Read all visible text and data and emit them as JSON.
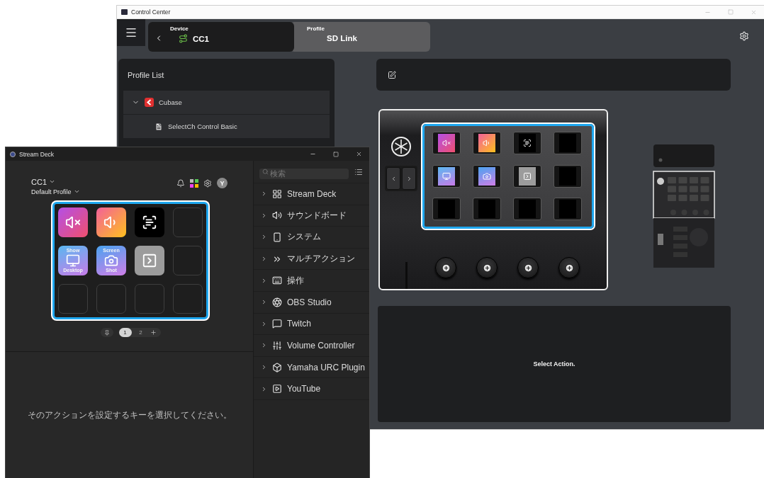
{
  "control_center": {
    "title": "Control Center",
    "tabs": [
      {
        "kind": "device",
        "label": "Device",
        "value": "CC1",
        "selected": true
      },
      {
        "kind": "profile",
        "label": "Profile",
        "value": "SD Link",
        "selected": false
      }
    ],
    "profile_list": {
      "title": "Profile List",
      "items": [
        {
          "kind": "app",
          "name": "Cubase",
          "expanded": true,
          "children": [
            {
              "kind": "file",
              "name": "SelectCh Control Basic"
            }
          ]
        }
      ]
    },
    "controller_keys": [
      {
        "kind": "mute"
      },
      {
        "kind": "volume"
      },
      {
        "kind": "text"
      },
      {
        "kind": "empty"
      },
      {
        "kind": "desktop"
      },
      {
        "kind": "screenshot"
      },
      {
        "kind": "switch"
      },
      {
        "kind": "empty"
      },
      {
        "kind": "empty"
      },
      {
        "kind": "empty"
      },
      {
        "kind": "empty"
      },
      {
        "kind": "empty"
      }
    ],
    "message": "Select Action."
  },
  "stream_deck": {
    "title": "Stream Deck",
    "device": "CC1",
    "profile": "Default Profile",
    "avatar": "Y",
    "keys": [
      {
        "kind": "mute"
      },
      {
        "kind": "volume"
      },
      {
        "kind": "text"
      },
      {
        "kind": "empty"
      },
      {
        "kind": "desktop",
        "top": "Show",
        "bottom": "Desktop"
      },
      {
        "kind": "screenshot",
        "top": "Screen",
        "bottom": "Shot"
      },
      {
        "kind": "switch"
      },
      {
        "kind": "empty"
      },
      {
        "kind": "empty"
      },
      {
        "kind": "empty"
      },
      {
        "kind": "empty"
      },
      {
        "kind": "empty"
      }
    ],
    "pages": [
      {
        "label": "1",
        "selected": true
      },
      {
        "label": "2",
        "selected": false
      }
    ],
    "message": "そのアクションを設定するキーを選択してください。",
    "search": {
      "placeholder": "検索"
    },
    "categories": [
      {
        "kind": "streamdeck",
        "name": "Stream Deck",
        "expanded": false
      },
      {
        "kind": "soundboard",
        "name": "サウンドボード",
        "expanded": false
      },
      {
        "kind": "system",
        "name": "システム",
        "expanded": false
      },
      {
        "kind": "multiaction",
        "name": "マルチアクション",
        "expanded": false
      },
      {
        "kind": "navigation",
        "name": "操作",
        "expanded": false
      },
      {
        "kind": "obs",
        "name": "OBS Studio",
        "expanded": false
      },
      {
        "kind": "twitch",
        "name": "Twitch",
        "expanded": false
      },
      {
        "kind": "volume",
        "name": "Volume Controller",
        "expanded": false
      },
      {
        "kind": "urc",
        "name": "Yamaha URC Plugin",
        "expanded": false
      },
      {
        "kind": "youtube",
        "name": "YouTube",
        "expanded": false
      }
    ]
  }
}
